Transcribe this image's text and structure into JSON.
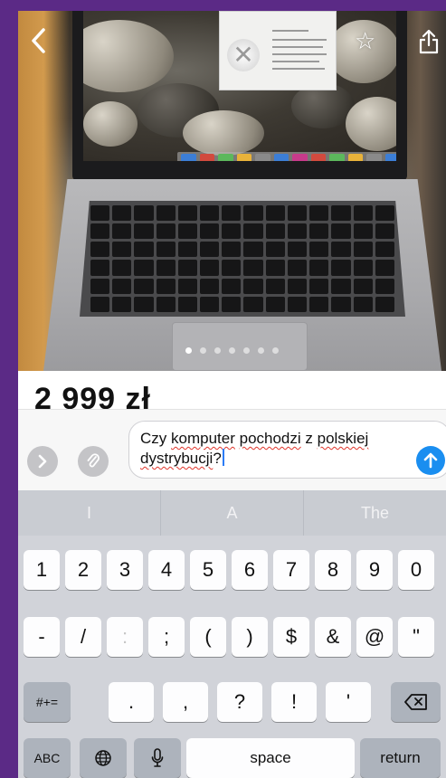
{
  "navigation": {
    "back_icon": "chevron-left-icon",
    "favorite_icon": "star-icon",
    "share_icon": "share-icon"
  },
  "gallery": {
    "pages": 7,
    "active_page": 1
  },
  "listing": {
    "price_partial": "2 999 zł"
  },
  "composer": {
    "text_parts": [
      "Czy ",
      "komputer",
      " ",
      "pochodzi",
      " z ",
      "polskiej",
      " ",
      "dystrybucji",
      "?"
    ],
    "next_icon": "chevron-right-icon",
    "attach_icon": "paperclip-icon",
    "send_icon": "arrow-up-icon"
  },
  "keyboard": {
    "suggestions": [
      "I",
      "A",
      "The"
    ],
    "row1": [
      "1",
      "2",
      "3",
      "4",
      "5",
      "6",
      "7",
      "8",
      "9",
      "0"
    ],
    "row2": [
      "-",
      "/",
      ":",
      ";",
      "(",
      ")",
      "$",
      "&",
      "@",
      "\""
    ],
    "row3": {
      "symbols_label": "#+=",
      "keys": [
        ".",
        ",",
        "?",
        "!",
        "'"
      ],
      "delete_icon": "backspace-icon"
    },
    "row4": {
      "abc_label": "ABC",
      "globe_icon": "globe-icon",
      "mic_icon": "microphone-icon",
      "space_label": "space",
      "return_label": "return"
    }
  },
  "colors": {
    "frame": "#5b2a86",
    "send_button": "#1a8ef0",
    "keyboard_bg": "#d1d3d9"
  }
}
